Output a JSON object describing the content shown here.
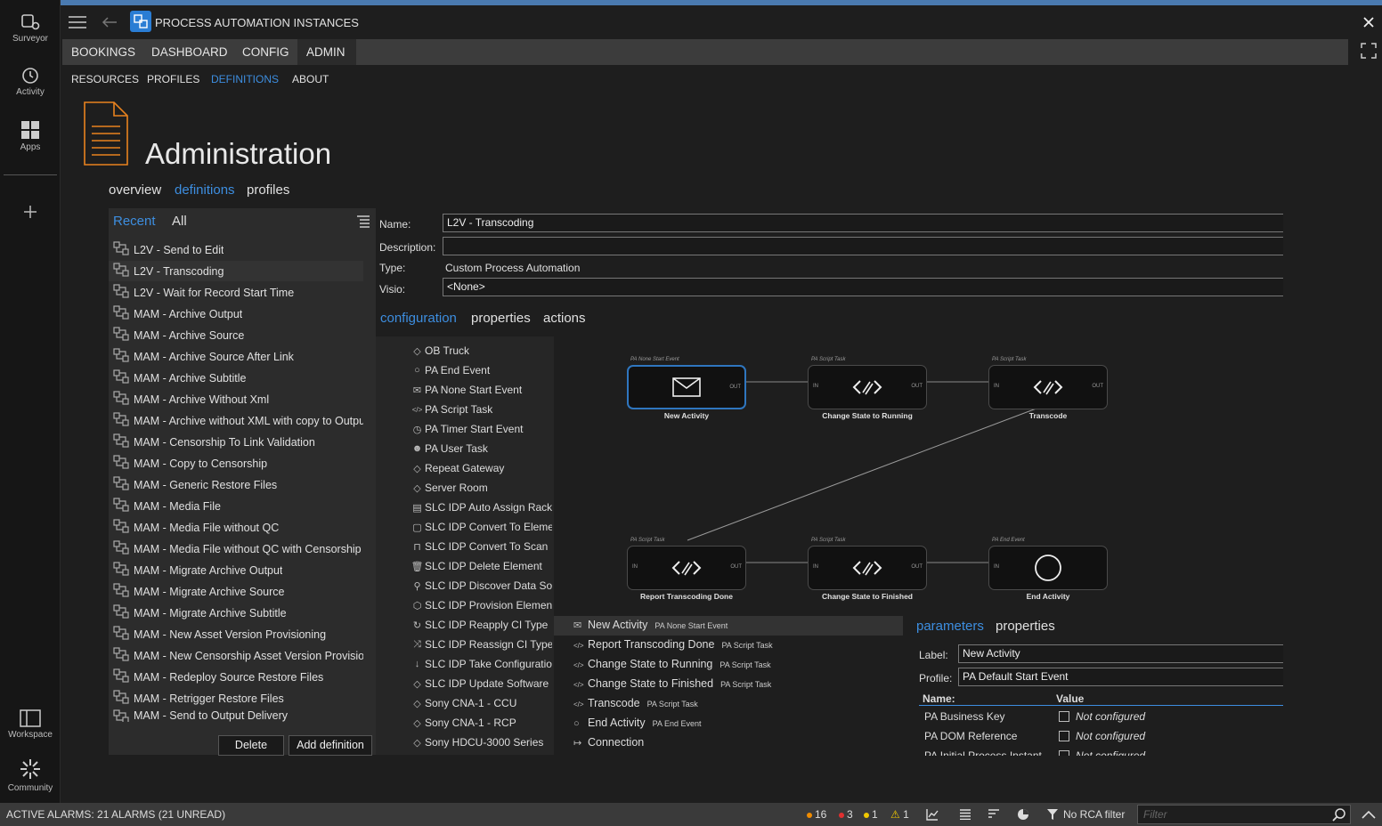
{
  "app": {
    "title": "PROCESS AUTOMATION INSTANCES",
    "sidebar": [
      {
        "label": "Surveyor",
        "icon": "surveyor-icon"
      },
      {
        "label": "Activity",
        "icon": "activity-icon"
      },
      {
        "label": "Apps",
        "icon": "apps-icon"
      },
      {
        "label": "Workspace",
        "icon": "workspace-icon"
      },
      {
        "label": "Community",
        "icon": "community-icon"
      }
    ]
  },
  "topnav": [
    "BOOKINGS",
    "DASHBOARD",
    "CONFIG",
    "ADMIN"
  ],
  "subnav": [
    "RESOURCES",
    "PROFILES",
    "DEFINITIONS",
    "ABOUT"
  ],
  "page": {
    "title": "Administration",
    "tabs": [
      "overview",
      "definitions",
      "profiles"
    ]
  },
  "list": {
    "tabs": [
      "Recent",
      "All"
    ],
    "items": [
      "L2V - Send to Edit",
      "L2V - Transcoding",
      "L2V - Wait for Record Start Time",
      "MAM - Archive Output",
      "MAM - Archive Source",
      "MAM - Archive Source After Link",
      "MAM - Archive Subtitle",
      "MAM - Archive Without Xml",
      "MAM - Archive without XML with copy to Output",
      "MAM - Censorship To Link Validation",
      "MAM - Copy to Censorship",
      "MAM - Generic Restore Files",
      "MAM - Media File",
      "MAM - Media File without QC",
      "MAM - Media File without QC with Censorship",
      "MAM - Migrate Archive Output",
      "MAM - Migrate Archive Source",
      "MAM - Migrate Archive Subtitle",
      "MAM - New Asset Version Provisioning",
      "MAM - New Censorship Asset Version Provisioning",
      "MAM - Redeploy Source Restore Files",
      "MAM - Retrigger Restore Files",
      "MAM - Send to Output Delivery"
    ],
    "delete_label": "Delete",
    "add_label": "Add definition"
  },
  "form": {
    "name_label": "Name:",
    "name_value": "L2V - Transcoding",
    "description_label": "Description:",
    "description_value": "",
    "type_label": "Type:",
    "type_value": "Custom Process Automation",
    "visio_label": "Visio:",
    "visio_value": "<None>"
  },
  "config_tabs": [
    "configuration",
    "properties",
    "actions"
  ],
  "palette": [
    {
      "label": "OB Truck",
      "icon": "◇"
    },
    {
      "label": "PA End Event",
      "icon": "○"
    },
    {
      "label": "PA None Start Event",
      "icon": "✉"
    },
    {
      "label": "PA Script Task",
      "icon": "</>"
    },
    {
      "label": "PA Timer Start Event",
      "icon": "◷"
    },
    {
      "label": "PA User Task",
      "icon": "☻"
    },
    {
      "label": "Repeat Gateway",
      "icon": "◇"
    },
    {
      "label": "Server Room",
      "icon": "◇"
    },
    {
      "label": "SLC IDP Auto Assign Rack",
      "icon": "▤"
    },
    {
      "label": "SLC IDP Convert To Element",
      "icon": "▢"
    },
    {
      "label": "SLC IDP Convert To Scan",
      "icon": "⊓"
    },
    {
      "label": "SLC IDP Delete Element",
      "icon": "🗑"
    },
    {
      "label": "SLC IDP Discover Data Source",
      "icon": "⚲"
    },
    {
      "label": "SLC IDP Provision Element",
      "icon": "⬡"
    },
    {
      "label": "SLC IDP Reapply CI Type",
      "icon": "↻"
    },
    {
      "label": "SLC IDP Reassign CI Type",
      "icon": "⤨"
    },
    {
      "label": "SLC IDP Take Configuration",
      "icon": "↓"
    },
    {
      "label": "SLC IDP Update Software",
      "icon": "◇"
    },
    {
      "label": "Sony CNA-1 - CCU",
      "icon": "◇"
    },
    {
      "label": "Sony CNA-1 - RCP",
      "icon": "◇"
    },
    {
      "label": "Sony HDCU-3000 Series",
      "icon": "◇"
    }
  ],
  "diagram": {
    "nodes": [
      {
        "tag": "PA None Start Event",
        "label": "New Activity",
        "glyph": "✉"
      },
      {
        "tag": "PA Script Task",
        "label": "Change State to Running",
        "glyph": "</>"
      },
      {
        "tag": "PA Script Task",
        "label": "Transcode",
        "glyph": "</>"
      },
      {
        "tag": "PA Script Task",
        "label": "Report Transcoding Done",
        "glyph": "</>"
      },
      {
        "tag": "PA Script Task",
        "label": "Change State to Finished",
        "glyph": "</>"
      },
      {
        "tag": "PA End Event",
        "label": "End Activity",
        "glyph": "○"
      }
    ],
    "in_label": "IN",
    "out_label": "OUT"
  },
  "elements": [
    {
      "label": "New Activity",
      "type": "PA None Start Event",
      "icon": "✉"
    },
    {
      "label": "Report Transcoding Done",
      "type": "PA Script Task",
      "icon": "</>"
    },
    {
      "label": "Change State to Running",
      "type": "PA Script Task",
      "icon": "</>"
    },
    {
      "label": "Change State to Finished",
      "type": "PA Script Task",
      "icon": "</>"
    },
    {
      "label": "Transcode",
      "type": "PA Script Task",
      "icon": "</>"
    },
    {
      "label": "End Activity",
      "type": "PA End Event",
      "icon": "○"
    },
    {
      "label": "Connection",
      "type": "",
      "icon": "↦"
    }
  ],
  "params": {
    "tabs": [
      "parameters",
      "properties"
    ],
    "label_label": "Label:",
    "label_value": "New Activity",
    "profile_label": "Profile:",
    "profile_value": "PA Default Start Event",
    "col_name": "Name:",
    "col_value": "Value",
    "rows": [
      {
        "name": "PA Business Key",
        "value": "Not configured"
      },
      {
        "name": "PA DOM Reference",
        "value": "Not configured"
      },
      {
        "name": "PA Initial Process Instant",
        "value": "Not configured"
      }
    ]
  },
  "status": {
    "alarms": "ACTIVE ALARMS: 21 ALARMS (21 UNREAD)",
    "count_orange": "16",
    "count_red": "3",
    "count_yellow": "1",
    "count_warning": "1",
    "rca": "No RCA filter",
    "filter_placeholder": "Filter",
    "colors": {
      "orange": "#f08c00",
      "red": "#e03030",
      "yellow": "#f0c800",
      "accent": "#3d8ee0"
    }
  }
}
